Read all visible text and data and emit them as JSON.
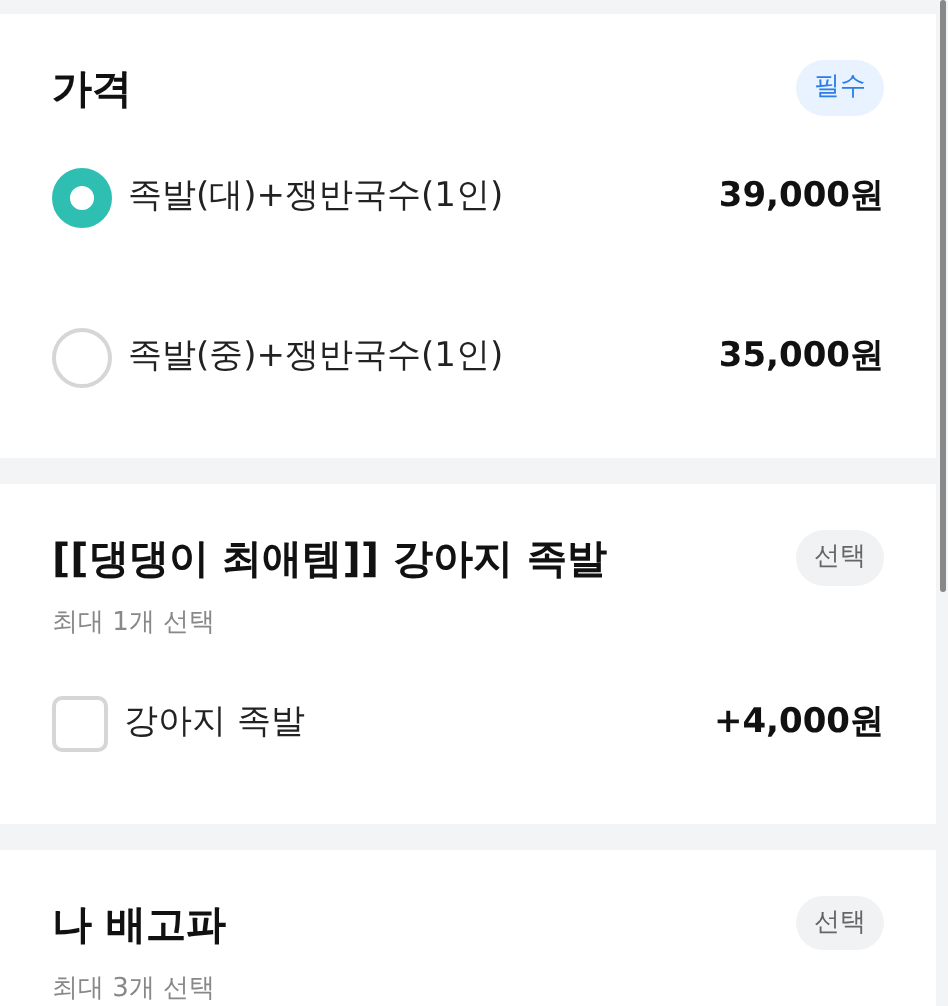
{
  "sections": [
    {
      "title": "가격",
      "badge": {
        "kind": "required",
        "label": "필수"
      },
      "options": [
        {
          "kind": "radio",
          "label": "족발(대)+쟁반국수(1인)",
          "price": "39,000원",
          "selected": true
        },
        {
          "kind": "radio",
          "label": "족발(중)+쟁반국수(1인)",
          "price": "35,000원",
          "selected": false
        }
      ]
    },
    {
      "title": "[[댕댕이 최애템]] 강아지 족발",
      "badge": {
        "kind": "optional",
        "label": "선택"
      },
      "subtitle": "최대 1개 선택",
      "options": [
        {
          "kind": "checkbox",
          "label": "강아지 족발",
          "price": "+4,000원",
          "checked": false
        }
      ]
    },
    {
      "title": "나 배고파",
      "badge": {
        "kind": "optional",
        "label": "선택"
      },
      "subtitle": "최대 3개 선택"
    }
  ]
}
